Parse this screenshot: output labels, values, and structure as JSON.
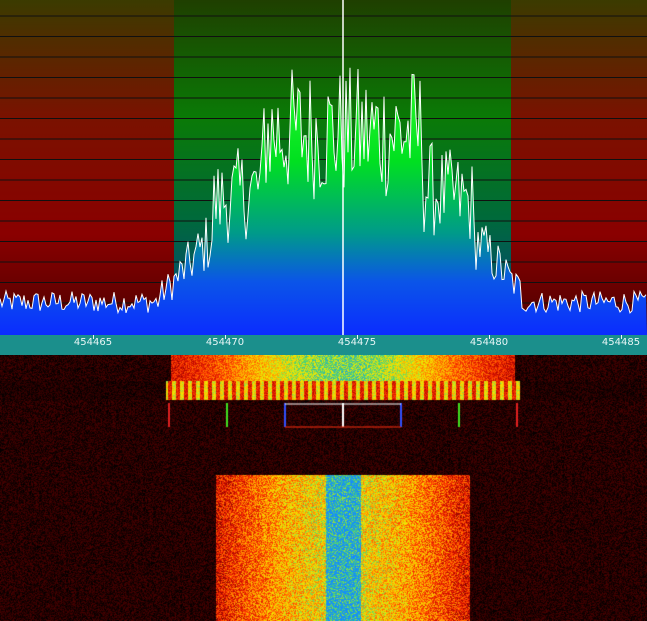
{
  "window": {
    "type": "sdr-spectrum-waterfall"
  },
  "frequency_axis": {
    "unit_label": "",
    "ticks": [
      "454465",
      "454470",
      "454475",
      "454480",
      "454485"
    ],
    "tick_values": [
      454465,
      454470,
      454475,
      454480,
      454485
    ],
    "visible_range": [
      454462.1,
      454486.5
    ]
  },
  "spectrum": {
    "passband": [
      454468.3,
      454481.1
    ],
    "tuned_center": 454475.0,
    "colors": {
      "passband_top": "#1e3c00",
      "passband_mid": "#00d81c",
      "passband_low": "#0c3cff",
      "outside_top": "#3a3a00",
      "outside_mid": "#8c0000",
      "noise_fill": "#0c2cff",
      "trace": "#ffffff",
      "gridline": "#1a1a1a",
      "center_marker": "#ffffff"
    },
    "gridline_count": 16
  },
  "bandwidth_markers": {
    "colors": {
      "outer": "#e02020",
      "mid": "#40e020",
      "inner": "#3050ff",
      "center": "#ffffff"
    },
    "offsets_khz": [
      -6.6,
      -4.4,
      -2.2,
      0,
      2.2,
      4.4,
      6.6
    ]
  },
  "waterfall": {
    "palette": [
      "#000000",
      "#7a0000",
      "#ff1a00",
      "#ffa000",
      "#f4f000",
      "#2fd08a",
      "#1a8cff"
    ]
  },
  "axis_color": "#1b8f8c"
}
